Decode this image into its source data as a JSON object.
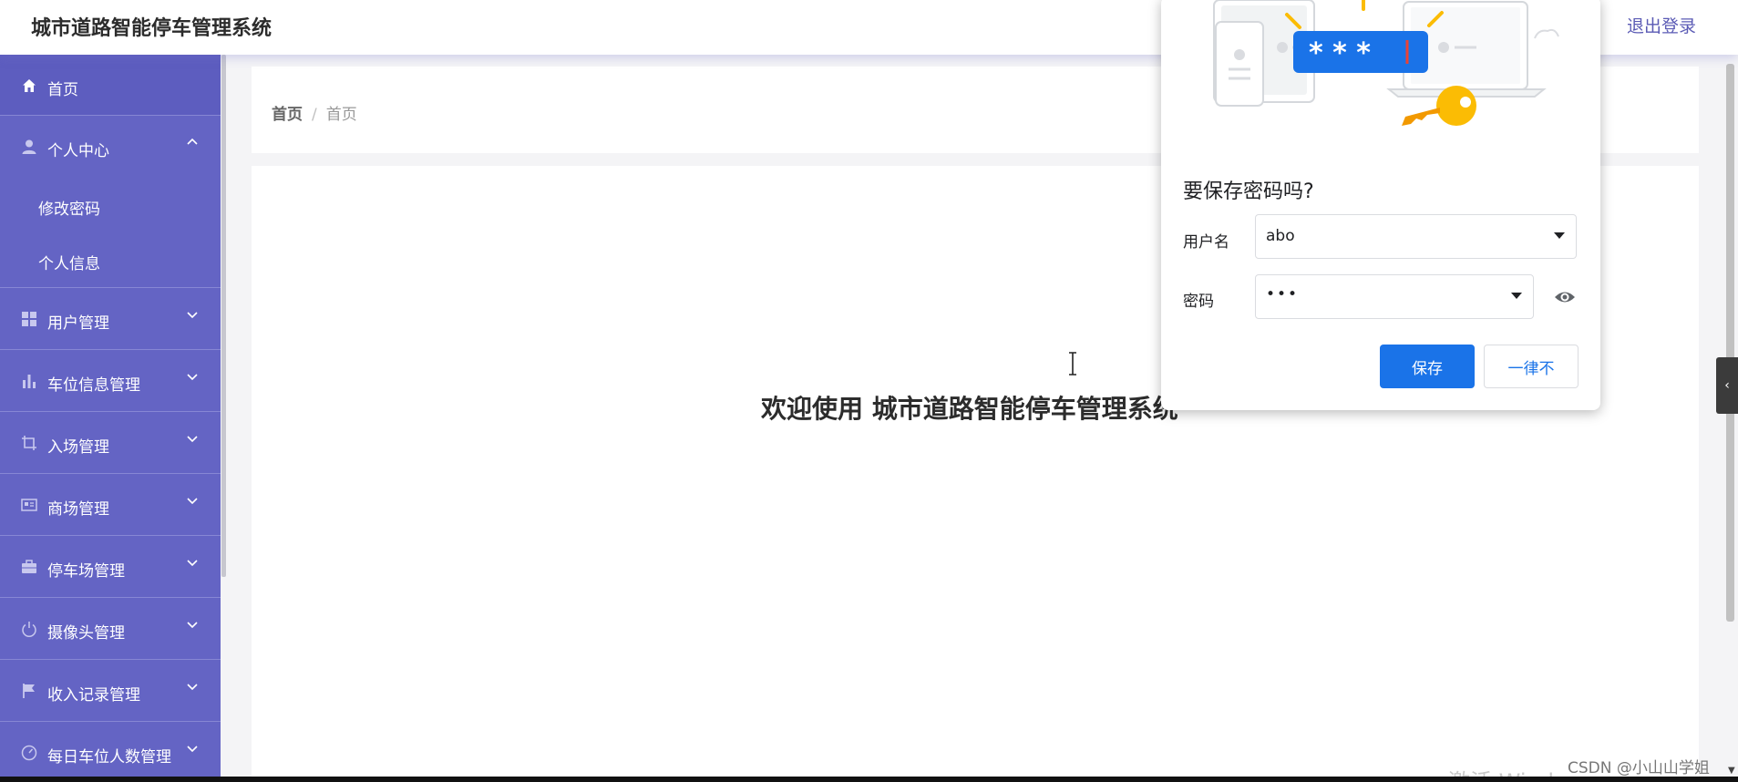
{
  "header": {
    "app_title": "城市道路智能停车管理系统",
    "logout_label": "退出登录",
    "tick": "、"
  },
  "sidebar": {
    "items": [
      {
        "label": "首页",
        "icon": "home-icon"
      },
      {
        "label": "个人中心",
        "icon": "user-icon",
        "expanded": true,
        "children": [
          {
            "label": "修改密码"
          },
          {
            "label": "个人信息"
          }
        ]
      },
      {
        "label": "用户管理",
        "icon": "grid-icon"
      },
      {
        "label": "车位信息管理",
        "icon": "bar-chart-icon"
      },
      {
        "label": "入场管理",
        "icon": "crop-icon"
      },
      {
        "label": "商场管理",
        "icon": "id-card-icon"
      },
      {
        "label": "停车场管理",
        "icon": "briefcase-icon"
      },
      {
        "label": "摄像头管理",
        "icon": "power-icon"
      },
      {
        "label": "收入记录管理",
        "icon": "flag-icon"
      },
      {
        "label": "每日车位人数管理",
        "icon": "gauge-icon"
      }
    ]
  },
  "breadcrumb": {
    "home": "首页",
    "separator": "/",
    "current": "首页"
  },
  "main": {
    "welcome": "欢迎使用 城市道路智能停车管理系统"
  },
  "password_dialog": {
    "title": "要保存密码吗?",
    "username_label": "用户名",
    "username_value": "abo",
    "password_label": "密码",
    "password_value": "•••",
    "save_label": "保存",
    "never_label": "一律不"
  },
  "overlay": {
    "side_tab": "‹",
    "watermark": "激活 Windows",
    "csdn": "CSDN @小山山学姐"
  },
  "colors": {
    "sidebar_bg": "#6464c4",
    "accent": "#1a73e8",
    "logout": "#5b5bb5"
  }
}
